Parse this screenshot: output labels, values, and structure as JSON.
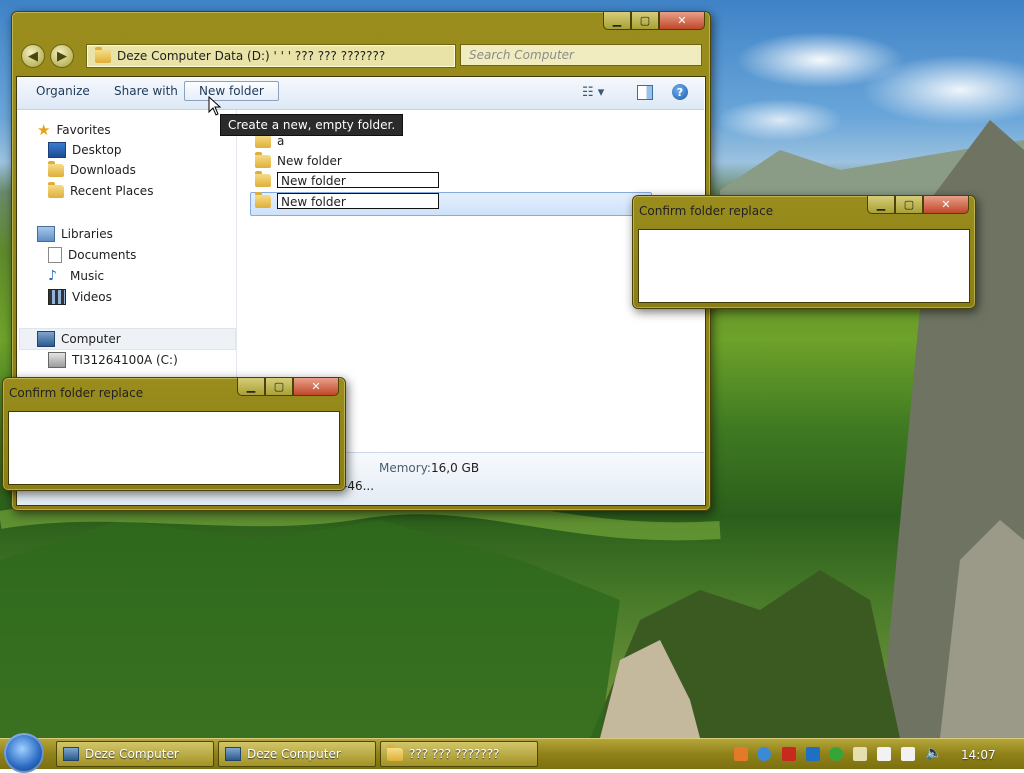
{
  "explorer": {
    "address": "Deze Computer  Data (D:)  ' ' '  ??? ??? ???????",
    "search_placeholder": "Search Computer",
    "toolbar": {
      "organize": "Organize",
      "share_with": "Share with",
      "new_folder": "New folder"
    },
    "tooltip": "Create a new, empty folder.",
    "nav": {
      "favorites": "Favorites",
      "desktop": "Desktop",
      "downloads": "Downloads",
      "recent_places": "Recent Places",
      "libraries": "Libraries",
      "documents": "Documents",
      "music": "Music",
      "videos": "Videos",
      "computer": "Computer",
      "drive_c": "TI31264100A (C:)"
    },
    "files": [
      {
        "name": "a"
      },
      {
        "name": "New folder"
      },
      {
        "name": "New folder"
      },
      {
        "name": "New folder"
      }
    ],
    "details": {
      "memory_label": "Memory:",
      "memory_value": "16,0 GB",
      "processor_partial": "-46..."
    }
  },
  "dialog1": {
    "title": "Confirm folder replace"
  },
  "dialog2": {
    "title": "Confirm folder replace"
  },
  "taskbar": {
    "tasks": [
      "Deze Computer",
      "Deze Computer",
      "??? ??? ???????"
    ],
    "clock": "14:07"
  },
  "icons": {
    "favorites": "star-icon",
    "computer": "computer-icon",
    "folder": "folder-icon",
    "help": "help-icon",
    "start": "windows-start-icon"
  },
  "colors": {
    "window_frame": "#8a7e16",
    "taskbar": "#8f8218",
    "accent_blue": "#2a6ac2"
  }
}
